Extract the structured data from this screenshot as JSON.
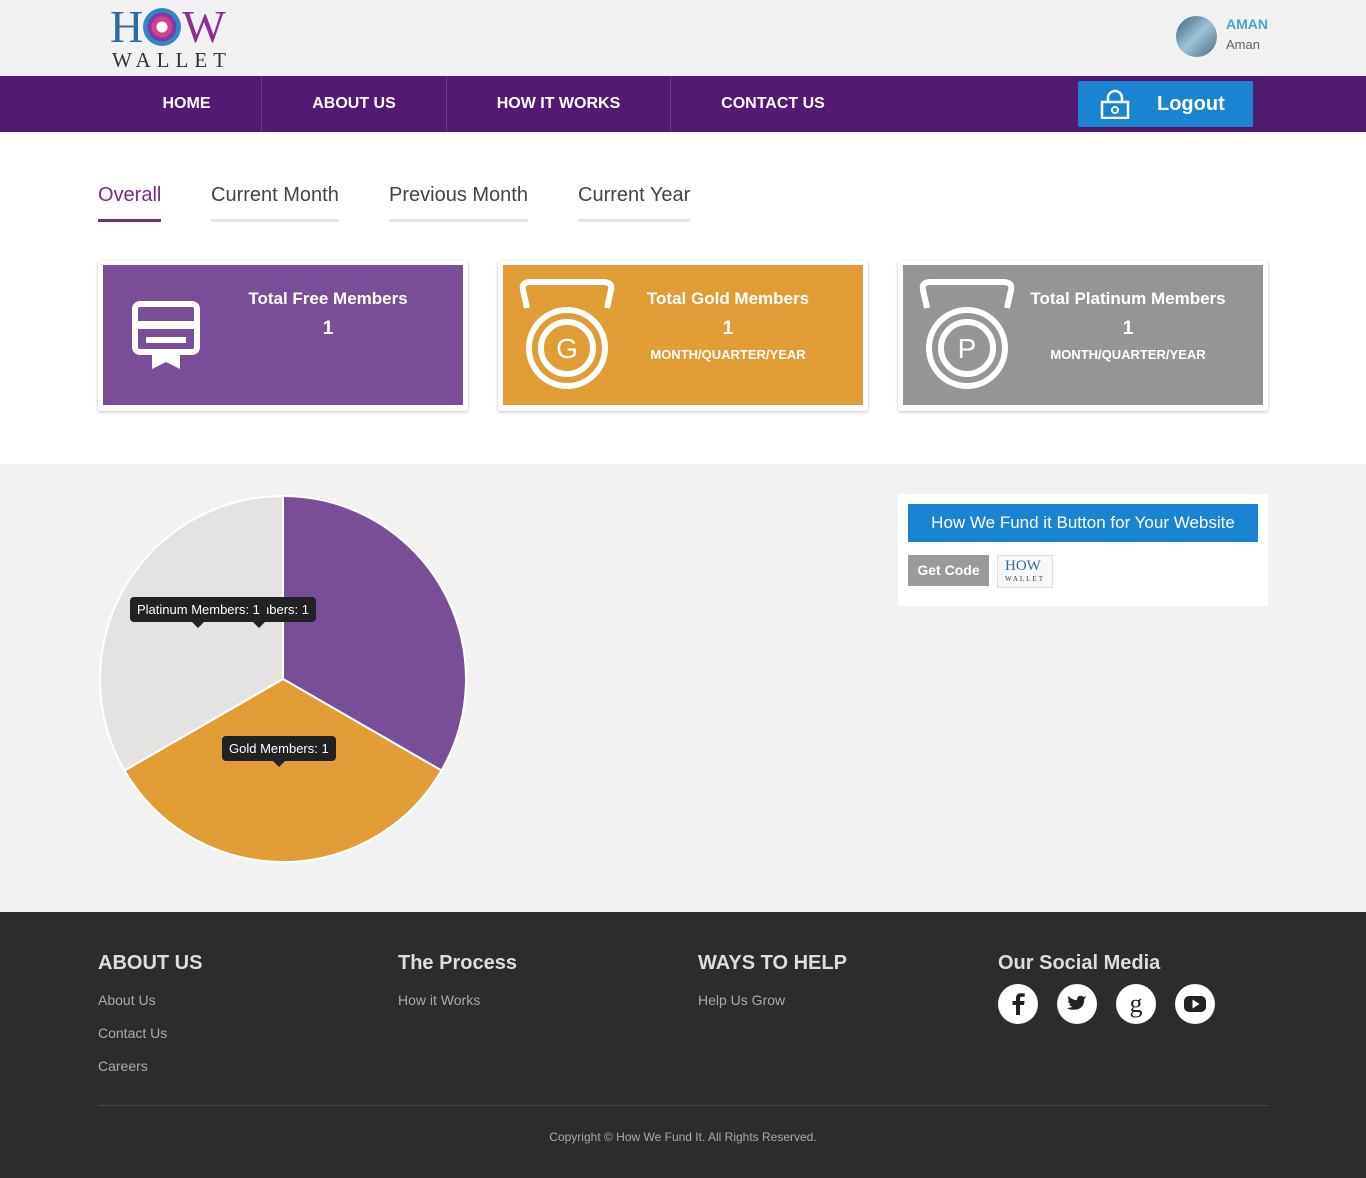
{
  "logo": {
    "how": "HOW",
    "wallet": "WALLET",
    "mini_how": "HOW",
    "mini_wallet": "WALLET"
  },
  "user": {
    "name": "AMAN",
    "subname": "Aman"
  },
  "nav": {
    "items": [
      "HOME",
      "ABOUT US",
      "HOW IT WORKS",
      "CONTACT US"
    ],
    "logout": "Logout"
  },
  "tabs": [
    "Overall",
    "Current Month",
    "Previous Month",
    "Current Year"
  ],
  "cards": [
    {
      "title": "Total Free Members",
      "count": "1",
      "sub": "",
      "color": "#784e98",
      "icon": "certificate-icon"
    },
    {
      "title": "Total Gold Members",
      "count": "1",
      "sub": "MONTH/QUARTER/YEAR",
      "color": "#e19c35",
      "icon": "gold-medal-icon"
    },
    {
      "title": "Total Platinum Members",
      "count": "1",
      "sub": "MONTH/QUARTER/YEAR",
      "color": "#959595",
      "icon": "platinum-medal-icon"
    }
  ],
  "chart_data": {
    "type": "pie",
    "categories": [
      "Free Members",
      "Gold Members",
      "Platinum Members"
    ],
    "values": [
      1,
      1,
      1
    ],
    "colors": [
      "#784e98",
      "#e19c35",
      "#e5e3e2"
    ],
    "labels": [
      "Free Members: 1",
      "Gold Members: 1",
      "Platinum Members: 1"
    ]
  },
  "widget": {
    "button": "How We Fund it Button for Your Website",
    "get_code": "Get Code"
  },
  "footer": {
    "cols": [
      {
        "heading": "ABOUT US",
        "links": [
          "About Us",
          "Contact Us",
          "Careers"
        ]
      },
      {
        "heading": "The Process",
        "links": [
          "How it Works"
        ]
      },
      {
        "heading": "WAYS TO HELP",
        "links": [
          "Help Us Grow"
        ]
      },
      {
        "heading": "Our Social Media",
        "links": []
      }
    ],
    "social": [
      "facebook-icon",
      "twitter-icon",
      "google-plus-icon",
      "youtube-icon"
    ],
    "copyright": "Copyright © How We Fund It. All Rights Reserved."
  }
}
